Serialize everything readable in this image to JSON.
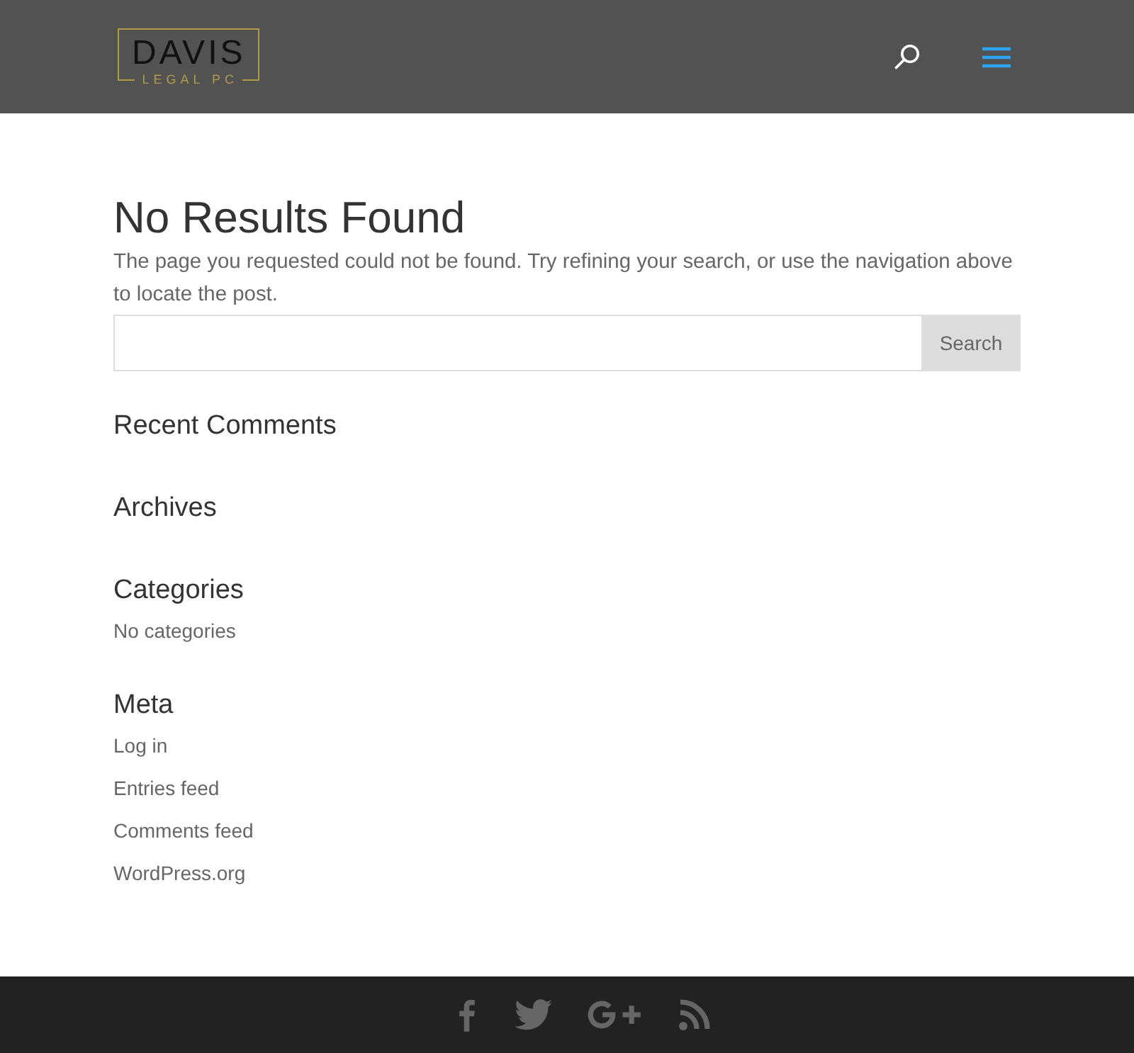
{
  "header": {
    "logo": {
      "name": "DAVIS",
      "tagline": "LEGAL PC"
    }
  },
  "main": {
    "title": "No Results Found",
    "message": "The page you requested could not be found. Try refining your search, or use the navigation above to locate the post.",
    "search": {
      "button": "Search"
    }
  },
  "widgets": [
    {
      "title": "Recent Comments"
    },
    {
      "title": "Archives"
    },
    {
      "title": "Categories",
      "text": "No categories"
    },
    {
      "title": "Meta",
      "links": [
        "Log in",
        "Entries feed",
        "Comments feed",
        "WordPress.org"
      ]
    }
  ],
  "footer": {
    "social": [
      {
        "kind": "facebook"
      },
      {
        "kind": "twitter"
      },
      {
        "kind": "google-plus"
      },
      {
        "kind": "rss"
      }
    ]
  }
}
